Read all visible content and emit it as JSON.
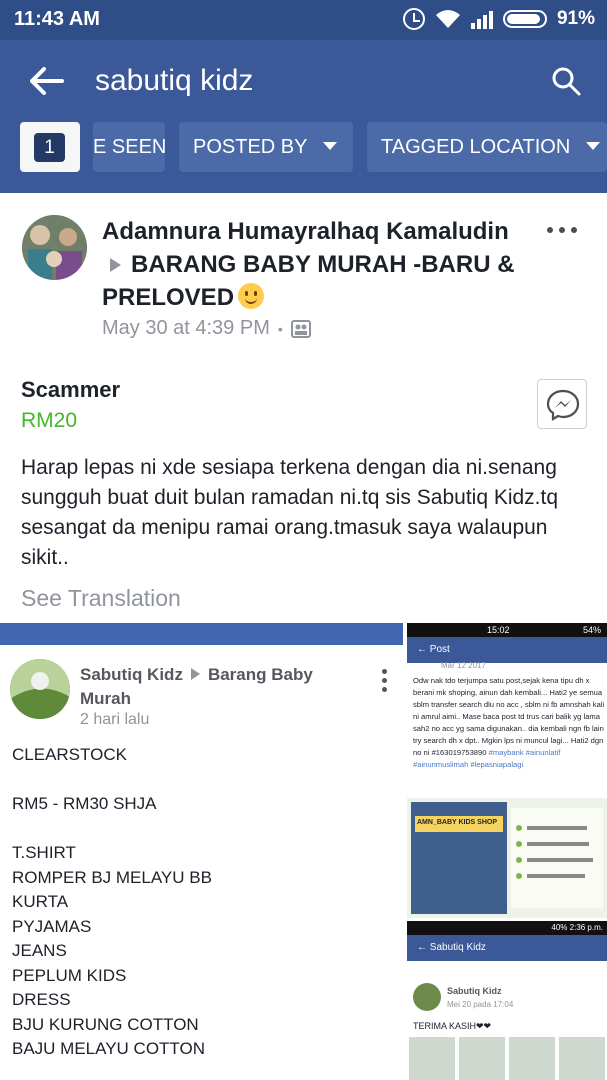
{
  "status_bar": {
    "time": "11:43 AM",
    "battery": "91%",
    "battery_level": 0.91
  },
  "header": {
    "search_query": "sabutiq kidz",
    "icons": {
      "back": "arrow-left-icon",
      "search": "search-icon"
    }
  },
  "filters": {
    "active_count": "1",
    "chips": [
      {
        "label": "E SEEN",
        "has_caret": false
      },
      {
        "label": "POSTED BY",
        "has_caret": true
      },
      {
        "label": "TAGGED LOCATION",
        "has_caret": true
      }
    ]
  },
  "post": {
    "author": "Adamnura Humayralhaq Kamaludin",
    "group": "BARANG BABY MURAH -BARU & PRELOVED",
    "time": "May 30 at 4:39 PM",
    "listing_title": "Scammer",
    "price": "RM20",
    "body": "Harap lepas ni xde sesiapa terkena dengan dia ni.senang sungguh buat duit bulan ramadan ni.tq sis Sabutiq Kidz.tq sesangat da menipu ramai orang.tmasuk saya walaupun sikit..",
    "see_translation": "See Translation",
    "colors": {
      "price": "#42b72a",
      "header": "#3b5998"
    }
  },
  "screenshot_left": {
    "name": "Sabutiq Kidz",
    "group": "Barang Baby Murah",
    "time": "2 hari lalu",
    "lines": [
      "CLEARSTOCK",
      "",
      "RM5 - RM30 SHJA",
      "",
      "T.SHIRT",
      "ROMPER BJ MELAYU BB",
      "KURTA",
      "PYJAMAS",
      "JEANS",
      "PEPLUM KIDS",
      "DRESS",
      "BJU KURUNG COTTON",
      "BAJU MELAYU COTTON"
    ]
  },
  "screenshot_right": {
    "status_time": "15:02",
    "status_battery": "54%",
    "bar_title": "Post",
    "date": "Mar 12 2017",
    "text": "Odw nak tdo terjumpa satu post,sejak kena tipu dh x berani mk shoping, ainun dah kembali... Hati2 ye semua sblm transfer search dlu no acc , sblm ni fb amnshah kali ni amrul aimi.. Mase baca post td trus cari balik yg lama sah2 no acc yg sama digunakan.. dia kembali ngn fb lain try search dh x dpt.. Mgkin lps ni muncul lagi... Hati2 dgn no ni #163019753890",
    "tags": "#maybank #ainunlatif #ainunmuslimah #lepasniapalagi",
    "flyer_title": "AMN_BABY KIDS SHOP",
    "status2": "40% 2:36 p.m.",
    "bar2_title": "Sabutiq Kidz",
    "post_name": "Sabutiq Kidz",
    "post_time": "Mei 20 pada 17:04",
    "post_text": "TERIMA KASIH❤❤"
  }
}
